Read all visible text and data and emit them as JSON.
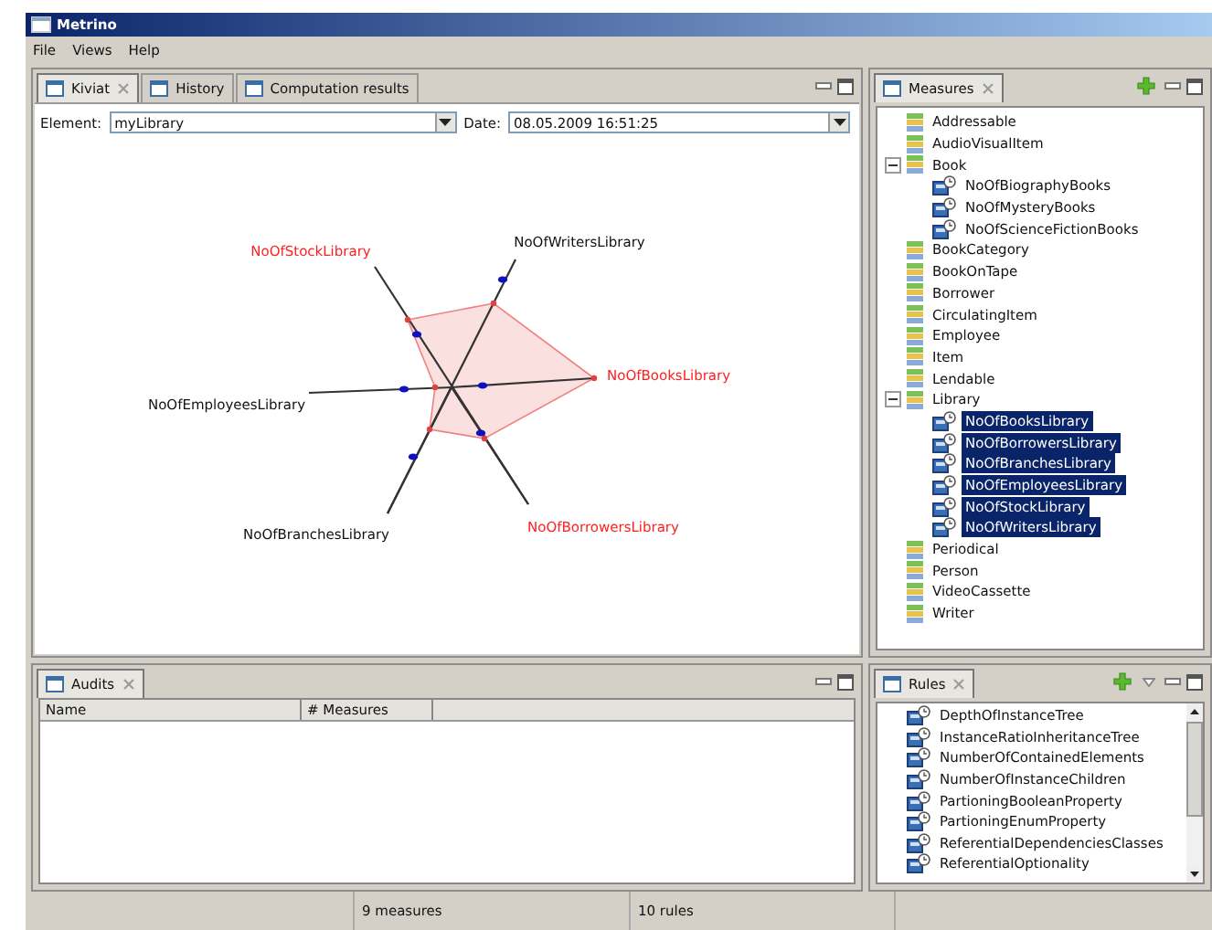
{
  "window": {
    "title": "Metrino"
  },
  "menu": [
    "File",
    "Views",
    "Help"
  ],
  "kiviat_panel": {
    "tabs": [
      {
        "label": "Kiviat",
        "selected": true,
        "closable": true
      },
      {
        "label": "History",
        "selected": false,
        "closable": false
      },
      {
        "label": "Computation results",
        "selected": false,
        "closable": false
      }
    ],
    "element": {
      "label": "Element:",
      "value": "myLibrary"
    },
    "date": {
      "label": "Date:",
      "value": "08.05.2009 16:51:25"
    },
    "axes": [
      {
        "label": "NoOfStockLibrary",
        "exceeded": true
      },
      {
        "label": "NoOfWritersLibrary",
        "exceeded": false
      },
      {
        "label": "NoOfBooksLibrary",
        "exceeded": true
      },
      {
        "label": "NoOfBorrowersLibrary",
        "exceeded": true
      },
      {
        "label": "NoOfBranchesLibrary",
        "exceeded": false
      },
      {
        "label": "NoOfEmployeesLibrary",
        "exceeded": false
      }
    ]
  },
  "audits": {
    "tab": {
      "label": "Audits",
      "closable": true
    },
    "columns": [
      "Name",
      "# Measures"
    ]
  },
  "measures": {
    "tab": {
      "label": "Measures",
      "closable": true
    },
    "items": [
      {
        "kind": "class",
        "label": "Addressable",
        "selected": false
      },
      {
        "kind": "class",
        "label": "AudioVisualItem",
        "selected": false
      },
      {
        "kind": "class",
        "label": "Book",
        "selected": false,
        "expanded": true,
        "children": [
          {
            "kind": "measure",
            "label": "NoOfBiographyBooks",
            "selected": false
          },
          {
            "kind": "measure",
            "label": "NoOfMysteryBooks",
            "selected": false
          },
          {
            "kind": "measure",
            "label": "NoOfScienceFictionBooks",
            "selected": false
          }
        ]
      },
      {
        "kind": "class",
        "label": "BookCategory",
        "selected": false
      },
      {
        "kind": "class",
        "label": "BookOnTape",
        "selected": false
      },
      {
        "kind": "class",
        "label": "Borrower",
        "selected": false
      },
      {
        "kind": "class",
        "label": "CirculatingItem",
        "selected": false
      },
      {
        "kind": "class",
        "label": "Employee",
        "selected": false
      },
      {
        "kind": "class",
        "label": "Item",
        "selected": false
      },
      {
        "kind": "class",
        "label": "Lendable",
        "selected": false
      },
      {
        "kind": "class",
        "label": "Library",
        "selected": false,
        "expanded": true,
        "children": [
          {
            "kind": "measure",
            "label": "NoOfBooksLibrary",
            "selected": true
          },
          {
            "kind": "measure",
            "label": "NoOfBorrowersLibrary",
            "selected": true
          },
          {
            "kind": "measure",
            "label": "NoOfBranchesLibrary",
            "selected": true
          },
          {
            "kind": "measure",
            "label": "NoOfEmployeesLibrary",
            "selected": true
          },
          {
            "kind": "measure",
            "label": "NoOfStockLibrary",
            "selected": true
          },
          {
            "kind": "measure",
            "label": "NoOfWritersLibrary",
            "selected": true
          }
        ]
      },
      {
        "kind": "class",
        "label": "Periodical",
        "selected": false
      },
      {
        "kind": "class",
        "label": "Person",
        "selected": false
      },
      {
        "kind": "class",
        "label": "VideoCassette",
        "selected": false
      },
      {
        "kind": "class",
        "label": "Writer",
        "selected": false
      }
    ]
  },
  "rules": {
    "tab": {
      "label": "Rules",
      "closable": true
    },
    "items": [
      {
        "label": "DepthOfInstanceTree"
      },
      {
        "label": "InstanceRatioInheritanceTree"
      },
      {
        "label": "NumberOfContainedElements"
      },
      {
        "label": "NumberOfInstanceChildren"
      },
      {
        "label": "PartioningBooleanProperty"
      },
      {
        "label": "PartioningEnumProperty"
      },
      {
        "label": "ReferentialDependenciesClasses"
      },
      {
        "label": "ReferentialOptionality"
      }
    ]
  },
  "status_bar": [
    "9 measures",
    "10 rules"
  ]
}
